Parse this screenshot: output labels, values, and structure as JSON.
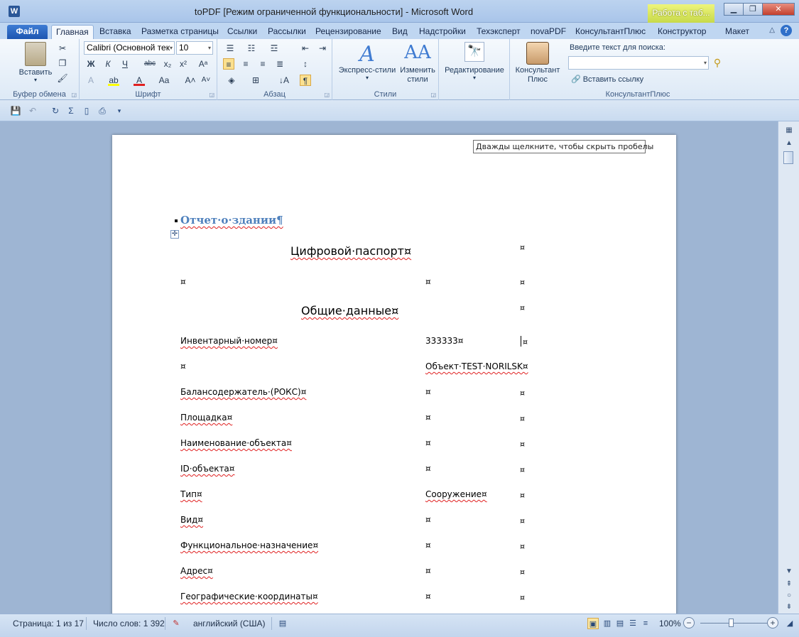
{
  "window": {
    "title": "toPDF [Режим ограниченной функциональности]  -  Microsoft Word",
    "context_tab_header": "Работа с таб..."
  },
  "tabs": {
    "file": "Файл",
    "items": [
      "Главная",
      "Вставка",
      "Разметка страницы",
      "Ссылки",
      "Рассылки",
      "Рецензирование",
      "Вид",
      "Надстройки",
      "Техэксперт",
      "novaPDF",
      "КонсультантПлюс",
      "Конструктор",
      "Макет"
    ]
  },
  "ribbon": {
    "clipboard": {
      "label": "Буфер обмена",
      "paste": "Вставить"
    },
    "font": {
      "label": "Шрифт",
      "font_name": "Calibri (Основной тек",
      "font_size": "10"
    },
    "paragraph": {
      "label": "Абзац"
    },
    "styles": {
      "label": "Стили",
      "express": "Экспресс-стили",
      "change": "Изменить стили"
    },
    "editing": {
      "label": "Редактирование"
    },
    "consultant": {
      "label": "КонсультантПлюс",
      "button": "Консультант Плюс",
      "search_label": "Введите текст для поиска:",
      "insert_link": "Вставить ссылку"
    }
  },
  "document": {
    "tooltip": "Дважды щелкните, чтобы скрыть пробелы",
    "heading": "Отчет·о·здании¶",
    "title1": "Цифровой·паспорт¤",
    "title2": "Общие·данные¤",
    "rows": [
      {
        "label": "Инвентарный·номер¤",
        "value": "333333¤"
      },
      {
        "label": "¤",
        "value": "Объект·TEST·NORILSK¤"
      },
      {
        "label": "Балансодержатель·(РОКС)¤",
        "value": "¤"
      },
      {
        "label": "Площадка¤",
        "value": "¤"
      },
      {
        "label": "Наименование·объекта¤",
        "value": "¤"
      },
      {
        "label": "ID·объекта¤",
        "value": "¤"
      },
      {
        "label": "Тип¤",
        "value": "Сооружение¤"
      },
      {
        "label": "Вид¤",
        "value": "¤"
      },
      {
        "label": "Функциональное·назначение¤",
        "value": "¤"
      },
      {
        "label": "Адрес¤",
        "value": "¤"
      },
      {
        "label": "Географические·координаты¤",
        "value": "¤"
      }
    ],
    "end_mark": "¤"
  },
  "status": {
    "page": "Страница: 1 из 17",
    "words": "Число слов: 1 392",
    "language": "английский (США)",
    "zoom": "100%",
    "zoom_level_percent": 100
  }
}
